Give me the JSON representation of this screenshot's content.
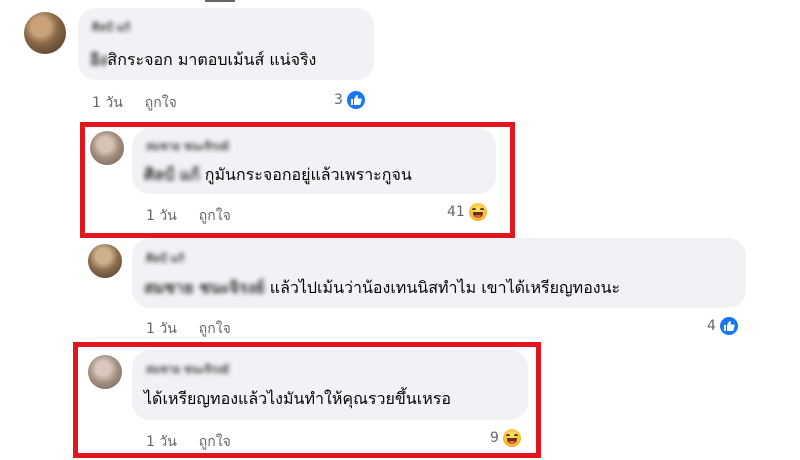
{
  "comments": [
    {
      "name": "ศิลป์ แก้",
      "prefix": "อิง",
      "text": "สิกระจอก มาตอบเม้นส์ แน่จริง",
      "time": "1 วัน",
      "like_label": "ถูกใจ",
      "reaction_count": "3",
      "reaction_icon": "like-icon"
    },
    {
      "name": "สมชาย ชนะจิรงย์",
      "mention": "ศิลป์ แก้",
      "text": "กูมันกระจอกอยู่แล้วเพราะกูจน",
      "time": "1 วัน",
      "like_label": "ถูกใจ",
      "reaction_count": "41",
      "reaction_icon": "haha-icon"
    },
    {
      "name": "ศิลป์ แก้",
      "mention": "สมชาย ชนะจิรงย์",
      "text": "แล้วไปเม้นว่าน้องเทนนิสทำไม เขาได้เหรียญทองนะ",
      "time": "1 วัน",
      "like_label": "ถูกใจ",
      "reaction_count": "4",
      "reaction_icon": "like-icon"
    },
    {
      "name": "สมชาย ชนะจิรงย์",
      "text": "ได้เหรียญทองแล้วไงมันทำให้คุณรวยขึ้นเหรอ",
      "time": "1 วัน",
      "like_label": "ถูกใจ",
      "reaction_count": "9",
      "reaction_icon": "haha-icon"
    }
  ],
  "colors": {
    "highlight_border": "#e4161d",
    "bubble": "#f0f2f5",
    "like_blue": "#1877f2",
    "meta_gray": "#65676b"
  }
}
